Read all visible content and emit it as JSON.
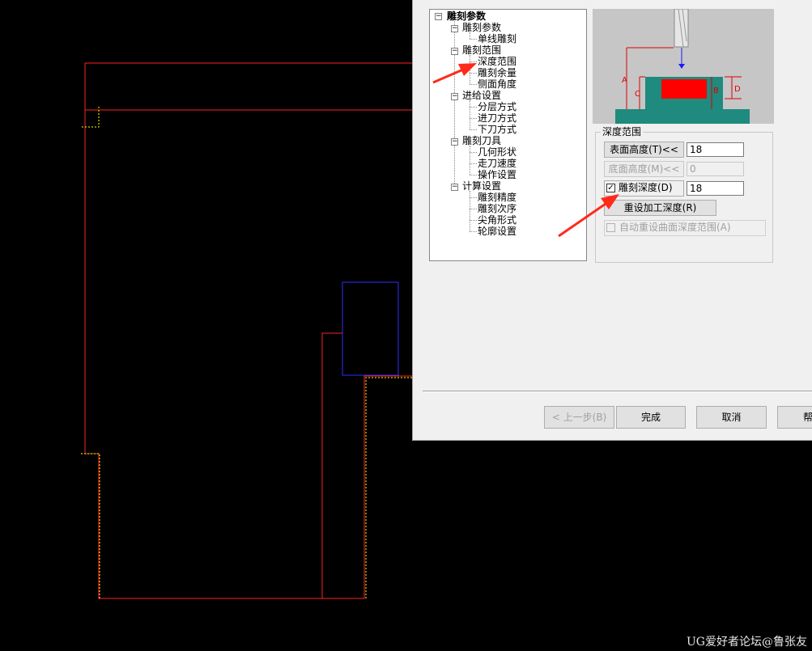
{
  "tree": {
    "root": "雕刻参数",
    "sections": [
      {
        "label": "雕刻参数",
        "children": [
          "单线雕刻"
        ]
      },
      {
        "label": "雕刻范围",
        "children": [
          "深度范围",
          "雕刻余量",
          "侧面角度"
        ]
      },
      {
        "label": "进给设置",
        "children": [
          "分层方式",
          "进刀方式",
          "下刀方式"
        ]
      },
      {
        "label": "雕刻刀具",
        "children": [
          "几何形状",
          "走刀速度",
          "操作设置"
        ]
      },
      {
        "label": "计算设置",
        "children": [
          "雕刻精度",
          "雕刻次序",
          "尖角形式",
          "轮廓设置"
        ]
      }
    ]
  },
  "preview": {
    "labels": {
      "a": "A",
      "b": "B",
      "c": "C",
      "d": "D"
    }
  },
  "depth_range": {
    "title": "深度范围",
    "surface_height_button": "表面高度(T)<<",
    "surface_height_value": "18",
    "bottom_height_button": "底面高度(M)<<",
    "bottom_height_value": "0",
    "engrave_depth_label": "雕刻深度(D)",
    "engrave_depth_checked": true,
    "engrave_depth_value": "18",
    "reset_depth_button": "重设加工深度(R)",
    "auto_reset_label": "自动重设曲面深度范围(A)",
    "auto_reset_checked": false
  },
  "buttons": {
    "prev": "< 上一步(B)",
    "finish": "完成",
    "cancel": "取消",
    "help": "帮"
  },
  "watermark": "UG爱好者论坛@鲁张友",
  "colors": {
    "cad_red": "#ff2020",
    "cad_blue": "#3030ff",
    "cad_yellow": "#ffff00",
    "arrow": "#ff2a1a",
    "teal": "#1f8a7e"
  }
}
